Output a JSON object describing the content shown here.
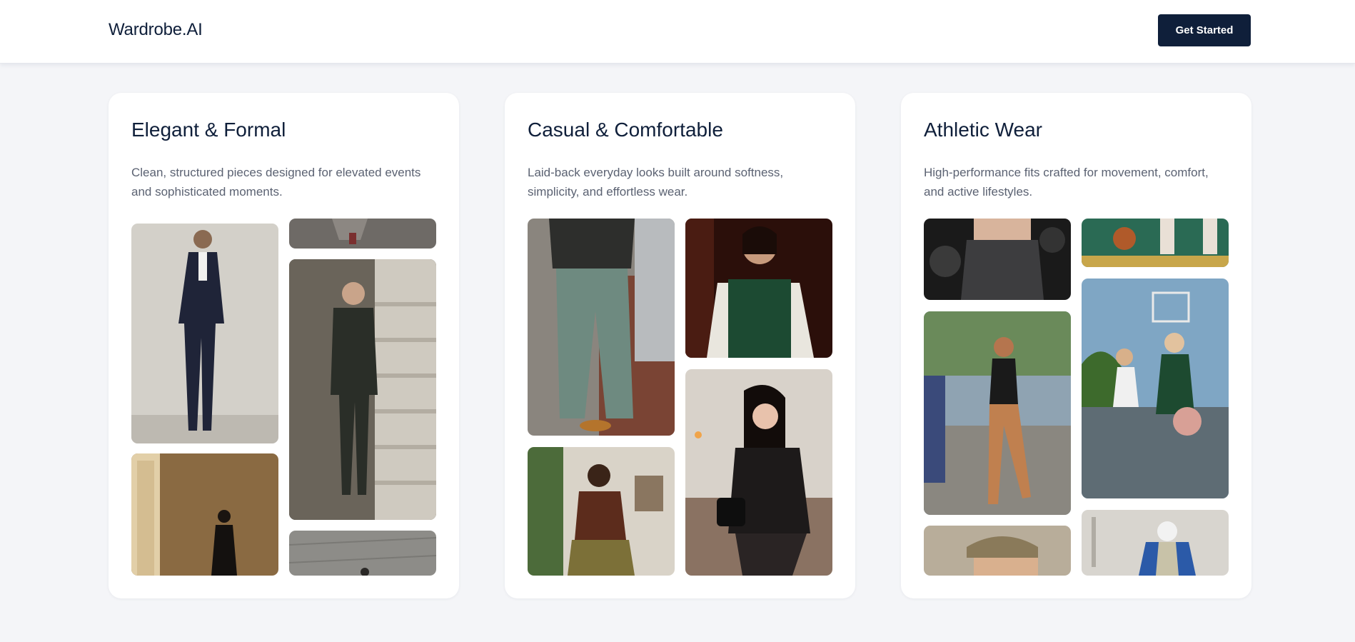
{
  "header": {
    "brand": "Wardrobe.AI",
    "cta_label": "Get Started"
  },
  "colors": {
    "navy": "#0f1f3a",
    "background": "#f4f5f8",
    "muted_text": "#5b6272"
  },
  "categories": [
    {
      "title": "Elegant & Formal",
      "description": "Clean, structured pieces designed for elevated events and sophisticated moments.",
      "photos": [
        "navy-double-breasted-suit",
        "stone-floor-top-crop",
        "grey-suit-on-stairs",
        "black-dress-in-doorway",
        "stone-floor-bottom-crop"
      ]
    },
    {
      "title": "Casual & Comfortable",
      "description": "Laid-back everyday looks built around softness, simplicity, and effortless wear.",
      "photos": [
        "vest-and-baggy-jeans",
        "green-knit-vest",
        "mirror-selfie-brown-top",
        "black-outfit-mirror-selfie"
      ]
    },
    {
      "title": "Athletic Wear",
      "description": "High-performance fits crafted for movement, comfort, and active lifestyles.",
      "photos": [
        "gym-shorts-crop",
        "basketball-court-sneakers",
        "running-woman-marathon",
        "basketball-players",
        "cap-and-sunglasses",
        "blue-windbreaker-cap"
      ]
    }
  ]
}
